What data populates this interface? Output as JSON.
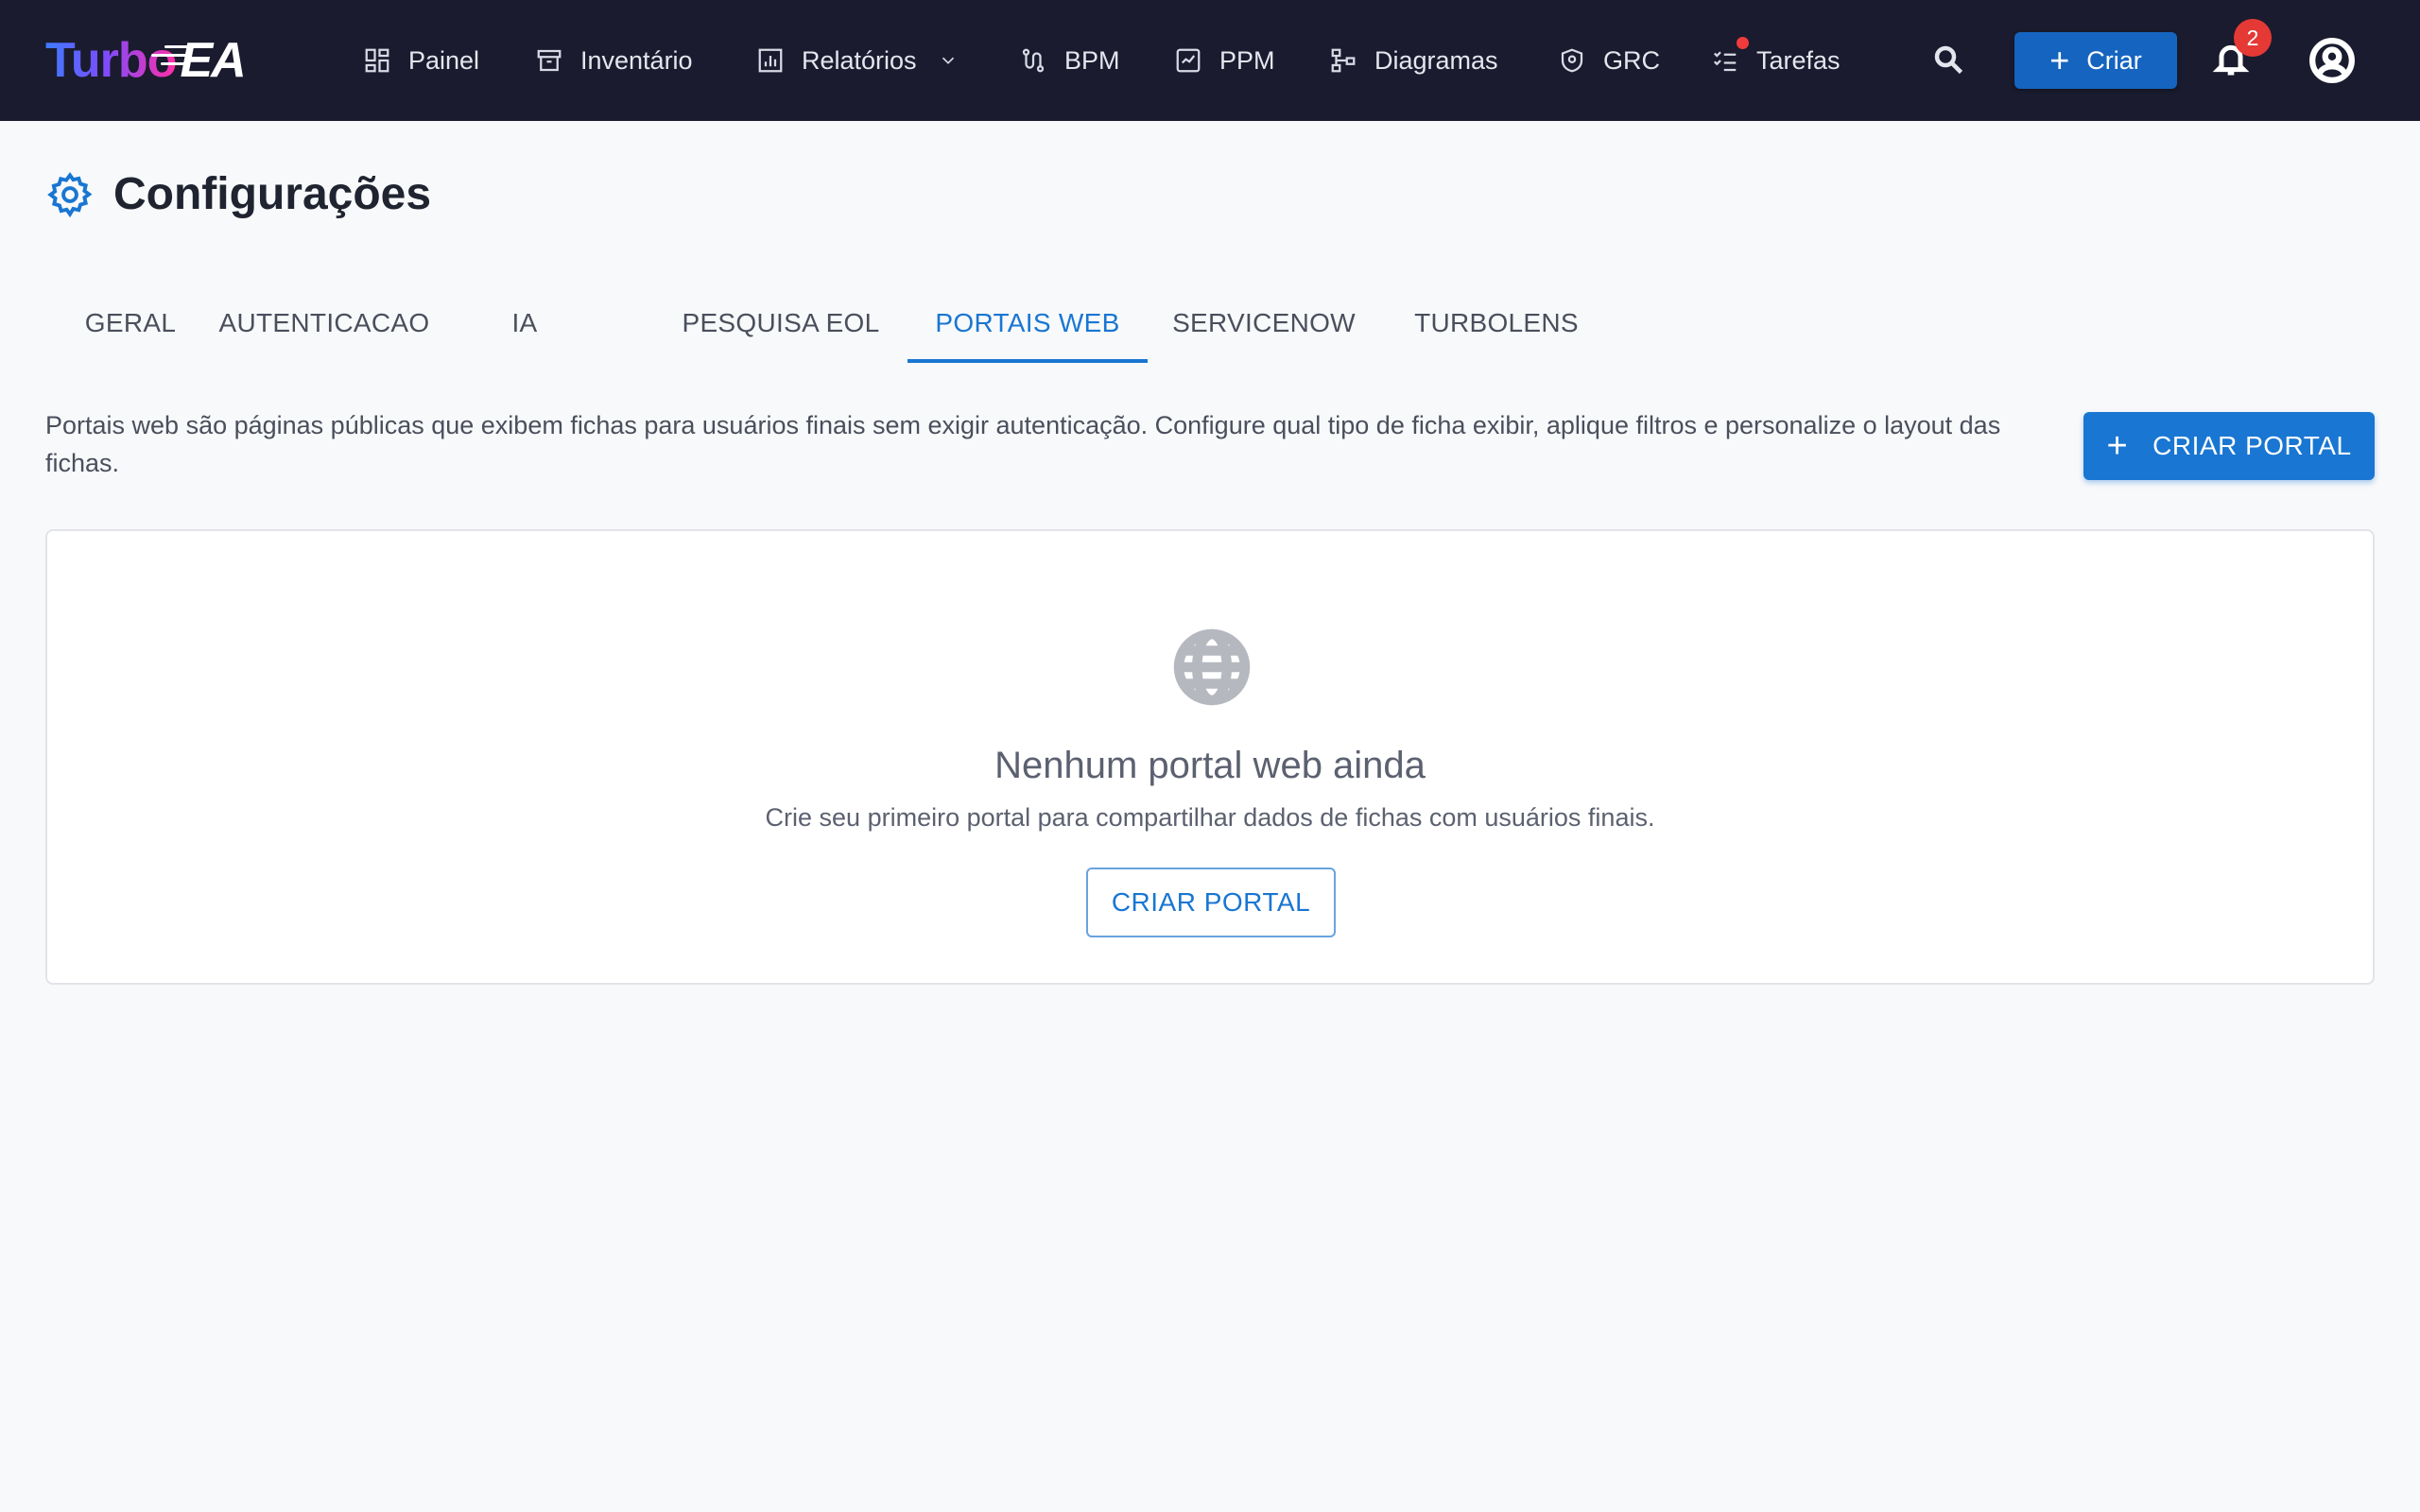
{
  "brand": {
    "part1": "Turbo",
    "part2": "EA"
  },
  "nav": {
    "items": [
      {
        "label": "Painel",
        "icon": "dashboard-icon"
      },
      {
        "label": "Inventário",
        "icon": "archive-icon"
      },
      {
        "label": "Relatórios",
        "icon": "report-icon"
      },
      {
        "label": "BPM",
        "icon": "process-icon"
      },
      {
        "label": "PPM",
        "icon": "project-icon"
      },
      {
        "label": "Diagramas",
        "icon": "diagram-icon"
      },
      {
        "label": "GRC",
        "icon": "shield-icon"
      },
      {
        "label": "Tarefas",
        "icon": "tasks-icon"
      }
    ],
    "create_label": "Criar",
    "notification_count": "2"
  },
  "page": {
    "title": "Configurações",
    "tabs": [
      {
        "label": "GERAL"
      },
      {
        "label": "AUTENTICACAO"
      },
      {
        "label": "IA"
      },
      {
        "label": "PESQUISA EOL"
      },
      {
        "label": "PORTAIS WEB"
      },
      {
        "label": "SERVICENOW"
      },
      {
        "label": "TURBOLENS"
      }
    ],
    "active_tab": "PORTAIS WEB",
    "description": "Portais web são páginas públicas que exibem fichas para usuários finais sem exigir autenticação. Configure qual tipo de ficha exibir, aplique filtros e personalize o layout das fichas.",
    "create_portal_label": "CRIAR PORTAL"
  },
  "empty_state": {
    "title": "Nenhum portal web ainda",
    "subtitle": "Crie seu primeiro portal para compartilhar dados de fichas com usuários finais.",
    "button_label": "CRIAR PORTAL"
  },
  "colors": {
    "topbar_bg": "#1a1b2e",
    "accent": "#1976d2",
    "badge": "#e53935"
  }
}
